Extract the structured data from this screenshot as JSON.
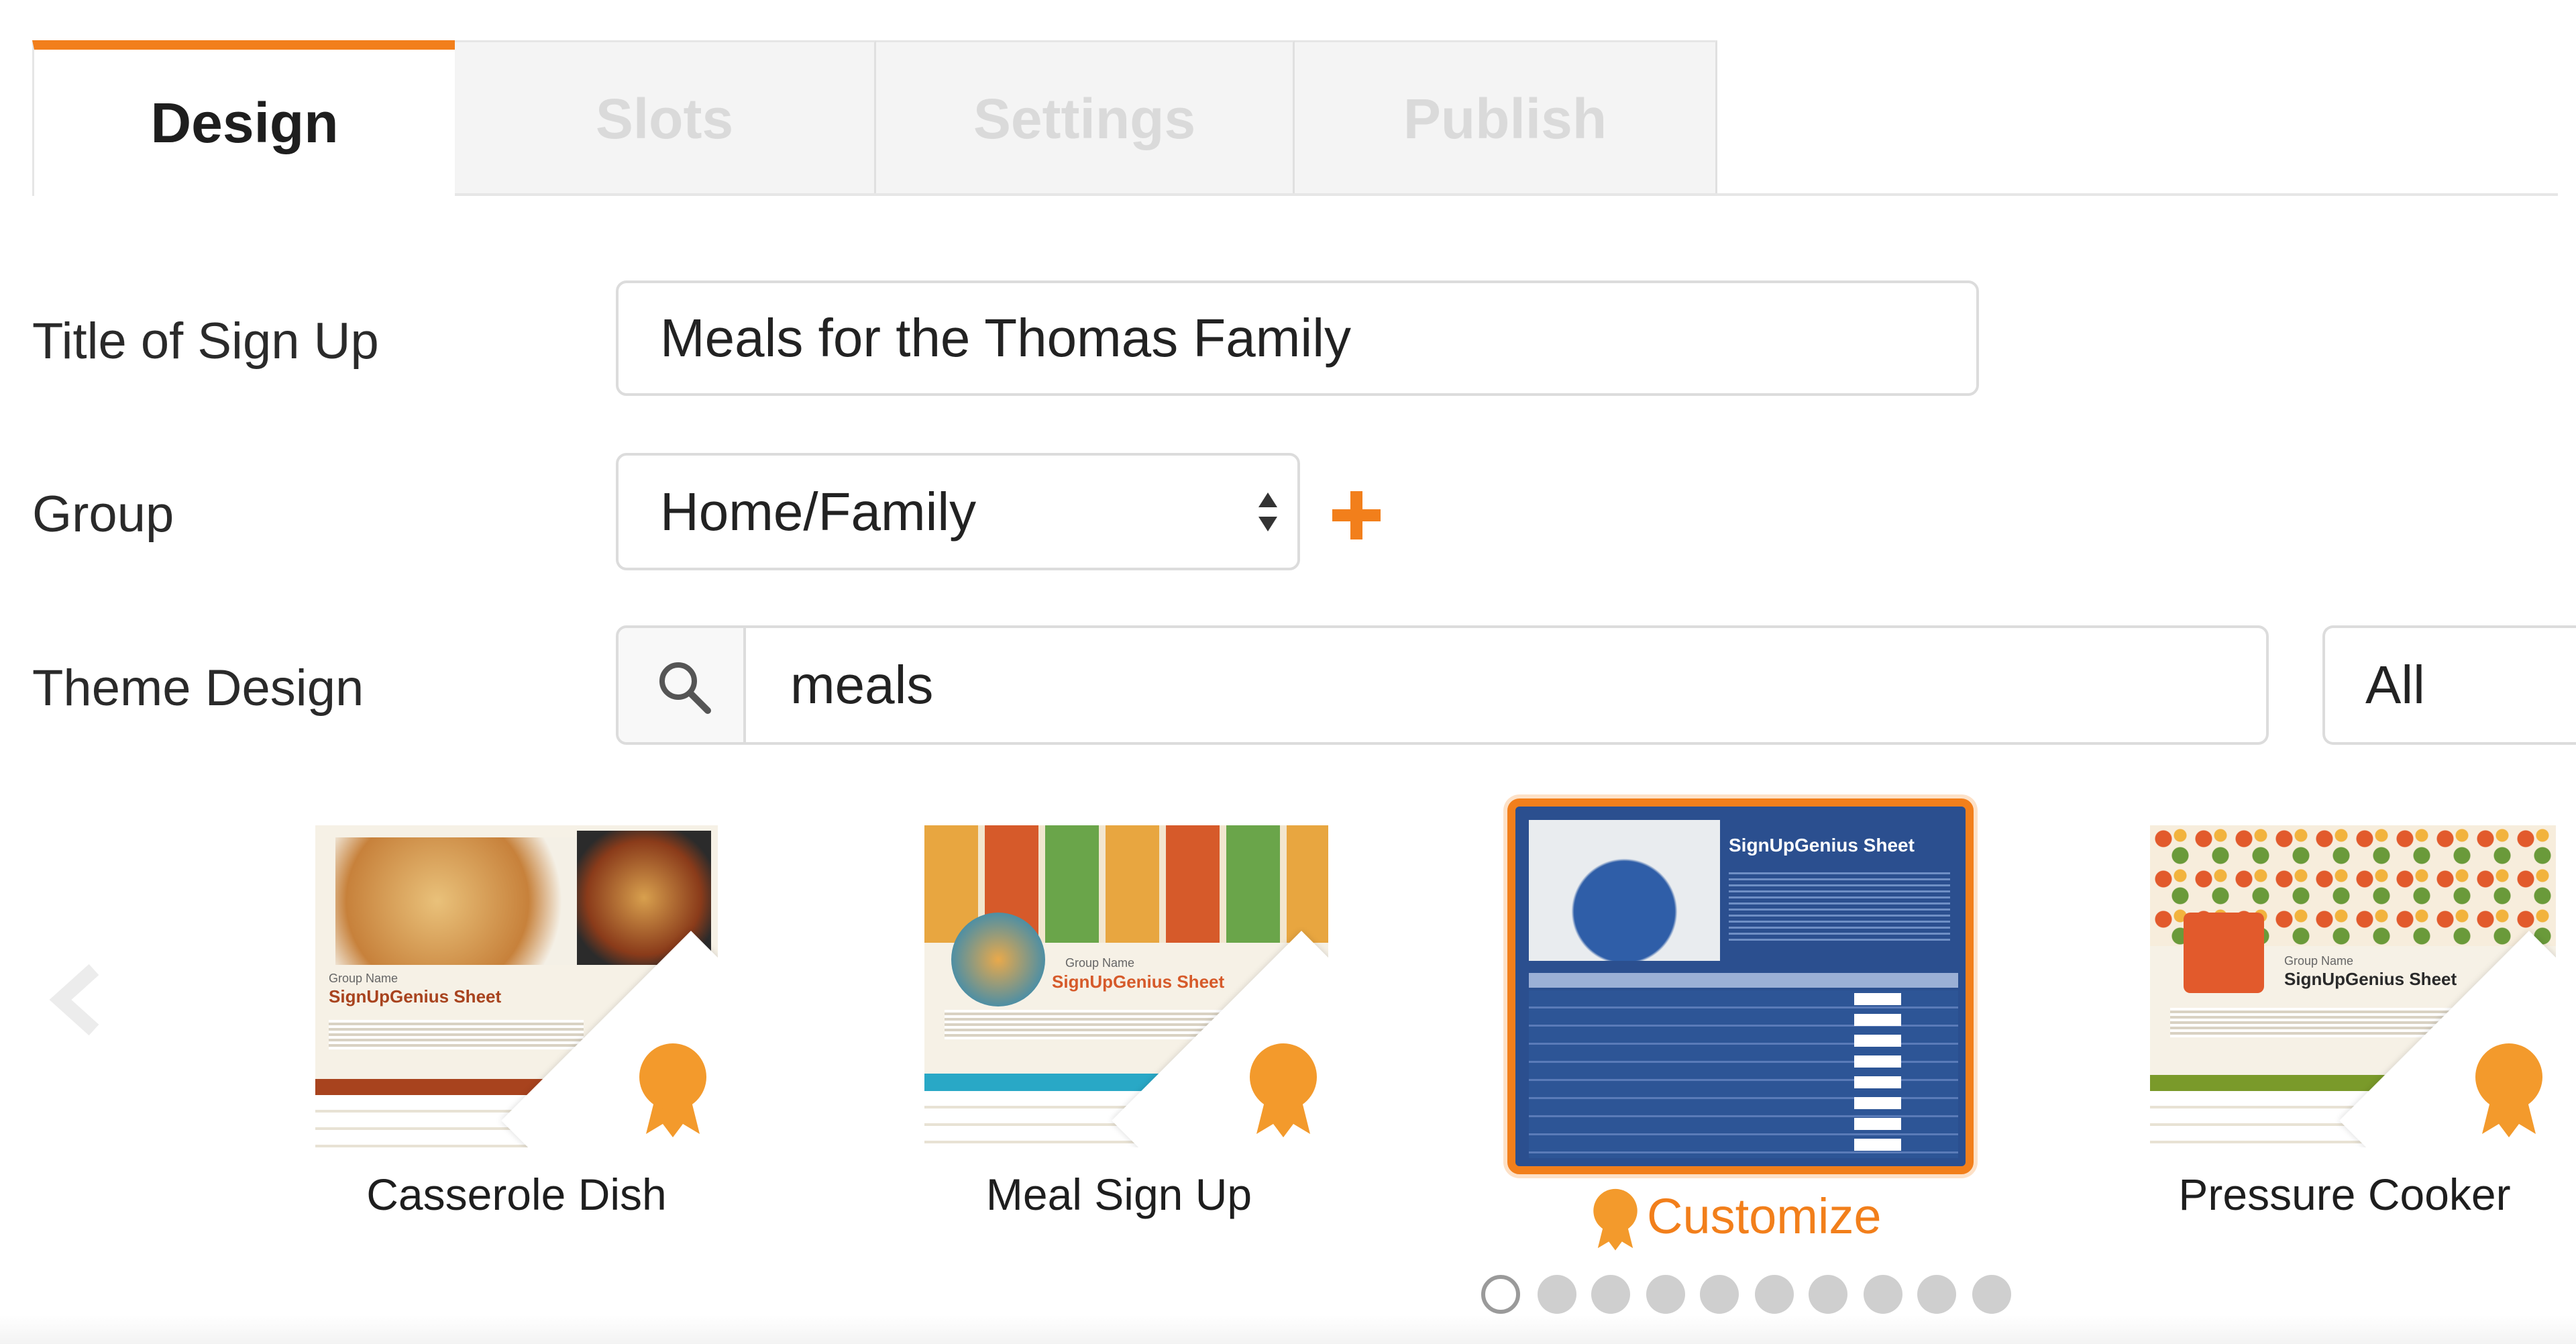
{
  "tabs": {
    "design": "Design",
    "slots": "Slots",
    "settings": "Settings",
    "publish": "Publish"
  },
  "form": {
    "title_label": "Title of Sign Up",
    "title_value": "Meals for the Thomas Family",
    "group_label": "Group",
    "group_value": "Home/Family",
    "add_group_icon": "plus-icon",
    "theme_label": "Theme Design",
    "theme_search_value": "meals",
    "theme_filter_value": "All"
  },
  "themes": {
    "cards": [
      {
        "label": "Casserole Dish"
      },
      {
        "label": "Meal Sign Up"
      },
      {
        "label": "Customize"
      },
      {
        "label": "Pressure Cooker"
      }
    ],
    "thumb_heading": "SignUpGenius Sheet",
    "thumb_subheading": "Group Name",
    "selected_index": 2,
    "page_count": 10,
    "active_page": 1
  },
  "colors": {
    "accent": "#f27f1b",
    "selected_theme_bg": "#2b4f8f",
    "casserole_band": "#a8431e",
    "meal_band": "#29a8c6",
    "pressure_band": "#7a9a2a"
  }
}
